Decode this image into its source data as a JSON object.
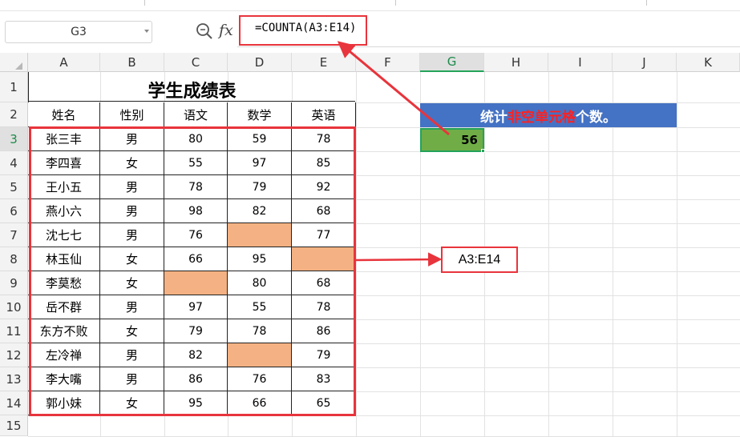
{
  "formula_bar": {
    "name_box": "G3",
    "fx_label": "fx",
    "formula": "=COUNTA(A3:E14)"
  },
  "columns": [
    "A",
    "B",
    "C",
    "D",
    "E",
    "F",
    "G",
    "H",
    "I",
    "J",
    "K"
  ],
  "rows": [
    "1",
    "2",
    "3",
    "4",
    "5",
    "6",
    "7",
    "8",
    "9",
    "10",
    "11",
    "12",
    "13",
    "14",
    "15"
  ],
  "table": {
    "title": "学生成绩表",
    "headers": [
      "姓名",
      "性别",
      "语文",
      "数学",
      "英语"
    ],
    "rows": [
      [
        "张三丰",
        "男",
        "80",
        "59",
        "78"
      ],
      [
        "李四喜",
        "女",
        "55",
        "97",
        "85"
      ],
      [
        "王小五",
        "男",
        "78",
        "79",
        "92"
      ],
      [
        "燕小六",
        "男",
        "98",
        "82",
        "68"
      ],
      [
        "沈七七",
        "男",
        "76",
        "",
        "77"
      ],
      [
        "林玉仙",
        "女",
        "66",
        "95",
        ""
      ],
      [
        "李莫愁",
        "女",
        "",
        "80",
        "68"
      ],
      [
        "岳不群",
        "男",
        "97",
        "55",
        "78"
      ],
      [
        "东方不败",
        "女",
        "79",
        "78",
        "86"
      ],
      [
        "左冷禅",
        "男",
        "82",
        "",
        "79"
      ],
      [
        "李大嘴",
        "男",
        "86",
        "76",
        "83"
      ],
      [
        "郭小妹",
        "女",
        "95",
        "66",
        "65"
      ]
    ]
  },
  "stat": {
    "label_prefix": "统计",
    "label_highlight": "非空单元格",
    "label_suffix": "个数。",
    "result": "56"
  },
  "callout": {
    "range_label": "A3:E14"
  },
  "colors": {
    "annotation_red": "#e8343c",
    "blank_cell": "#f4b183",
    "label_blue": "#4472c4",
    "result_green": "#70ad47",
    "selection_green": "#23a35a"
  }
}
